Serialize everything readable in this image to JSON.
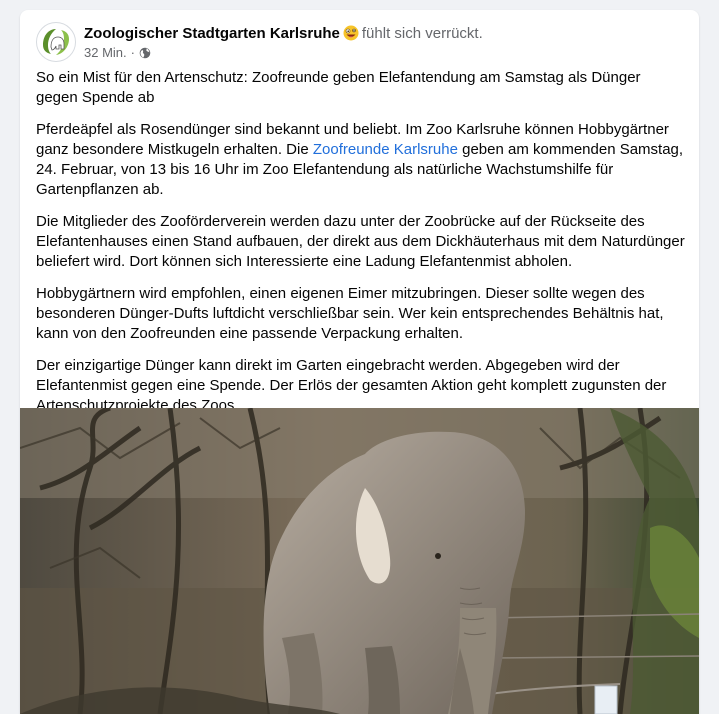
{
  "post": {
    "author": "Zoologischer Stadtgarten Karlsruhe",
    "feeling": "fühlt sich verrückt.",
    "time": "32 Min.",
    "separator": "·",
    "privacy_icon": "globe-icon",
    "feeling_icon": "crazy-face-emoji",
    "colors": {
      "link": "#216fdb",
      "text": "#050505",
      "secondary": "#65676b"
    }
  },
  "content": {
    "headline": "So ein Mist für den Artenschutz: Zoofreunde geben Elefantendung am Samstag als Dünger gegen Spende ab",
    "p2_before": "Pferdeäpfel als Rosendünger sind bekannt und beliebt. Im Zoo Karlsruhe können Hobbygärtner ganz besondere Mistkugeln erhalten. Die ",
    "p2_link": "Zoofreunde Karlsruhe",
    "p2_after": " geben am kommenden Samstag, 24. Februar, von 13 bis 16 Uhr im Zoo Elefantendung als natürliche Wachstumshilfe für Gartenpflanzen ab.",
    "p3": "Die Mitglieder des Zooförderverein werden dazu unter der Zoobrücke auf der Rückseite des Elefantenhauses einen Stand aufbauen, der direkt aus dem Dickhäuterhaus mit dem Naturdünger beliefert wird. Dort können sich Interessierte eine Ladung Elefantenmist abholen.",
    "p4": "Hobbygärtnern wird empfohlen, einen eigenen Eimer mitzubringen. Dieser sollte wegen des besonderen Dünger-Dufts luftdicht verschließbar sein. Wer kein entsprechendes Behältnis hat, kann von den Zoofreunden eine passende Verpackung erhalten.",
    "p5": "Der einzigartige Dünger kann direkt im Garten eingebracht werden. Abgegeben wird der Elefantenmist gegen eine Spende. Der Erlös der gesamten Aktion geht komplett zugunsten der Artenschutzprojekte des Zoos."
  }
}
